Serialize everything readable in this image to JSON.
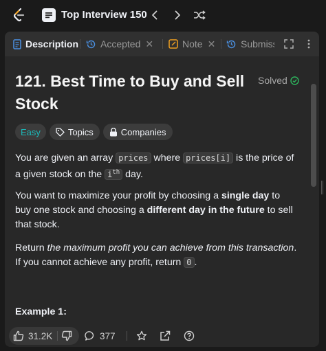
{
  "topbar": {
    "list_title": "Top Interview 150",
    "icons": {
      "logo": "leetcode-logo",
      "list": "list-icon",
      "prev": "chevron-left-icon",
      "next": "chevron-right-icon",
      "shuffle": "shuffle-icon"
    }
  },
  "tabs": [
    {
      "label": "Description",
      "icon": "description-icon",
      "active": true
    },
    {
      "label": "Accepted",
      "icon": "history-icon",
      "active": false
    },
    {
      "label": "Note",
      "icon": "note-icon",
      "active": false
    },
    {
      "label": "Submiss",
      "icon": "history-icon",
      "active": false
    }
  ],
  "problem": {
    "title": "121. Best Time to Buy and Sell Stock",
    "status": "Solved",
    "difficulty": "Easy",
    "topics_label": "Topics",
    "companies_label": "Companies",
    "p1": {
      "a": "You are given an array ",
      "code1": "prices",
      "b": " where ",
      "code2": "prices[i]",
      "c": " is the price of a given stock on the ",
      "code3": "i",
      "sup": "th",
      "d": " day."
    },
    "p2": {
      "a": "You want to maximize your profit by choosing a ",
      "b1": "single day",
      "c": " to buy one stock and choosing a ",
      "b2": "different day in the future",
      "d": " to sell that stock."
    },
    "p3": {
      "a": "Return ",
      "i1": "the maximum profit you can achieve from this transaction",
      "b": ". If you cannot achieve any profit, return ",
      "code1": "0",
      "c": "."
    },
    "example_heading": "Example 1:"
  },
  "bottom": {
    "likes": "31.2K",
    "comments": "377"
  },
  "colors": {
    "easy": "#1cb8b8",
    "solved": "#2db55d",
    "panel": "#282828",
    "background": "#1a1a1a"
  }
}
